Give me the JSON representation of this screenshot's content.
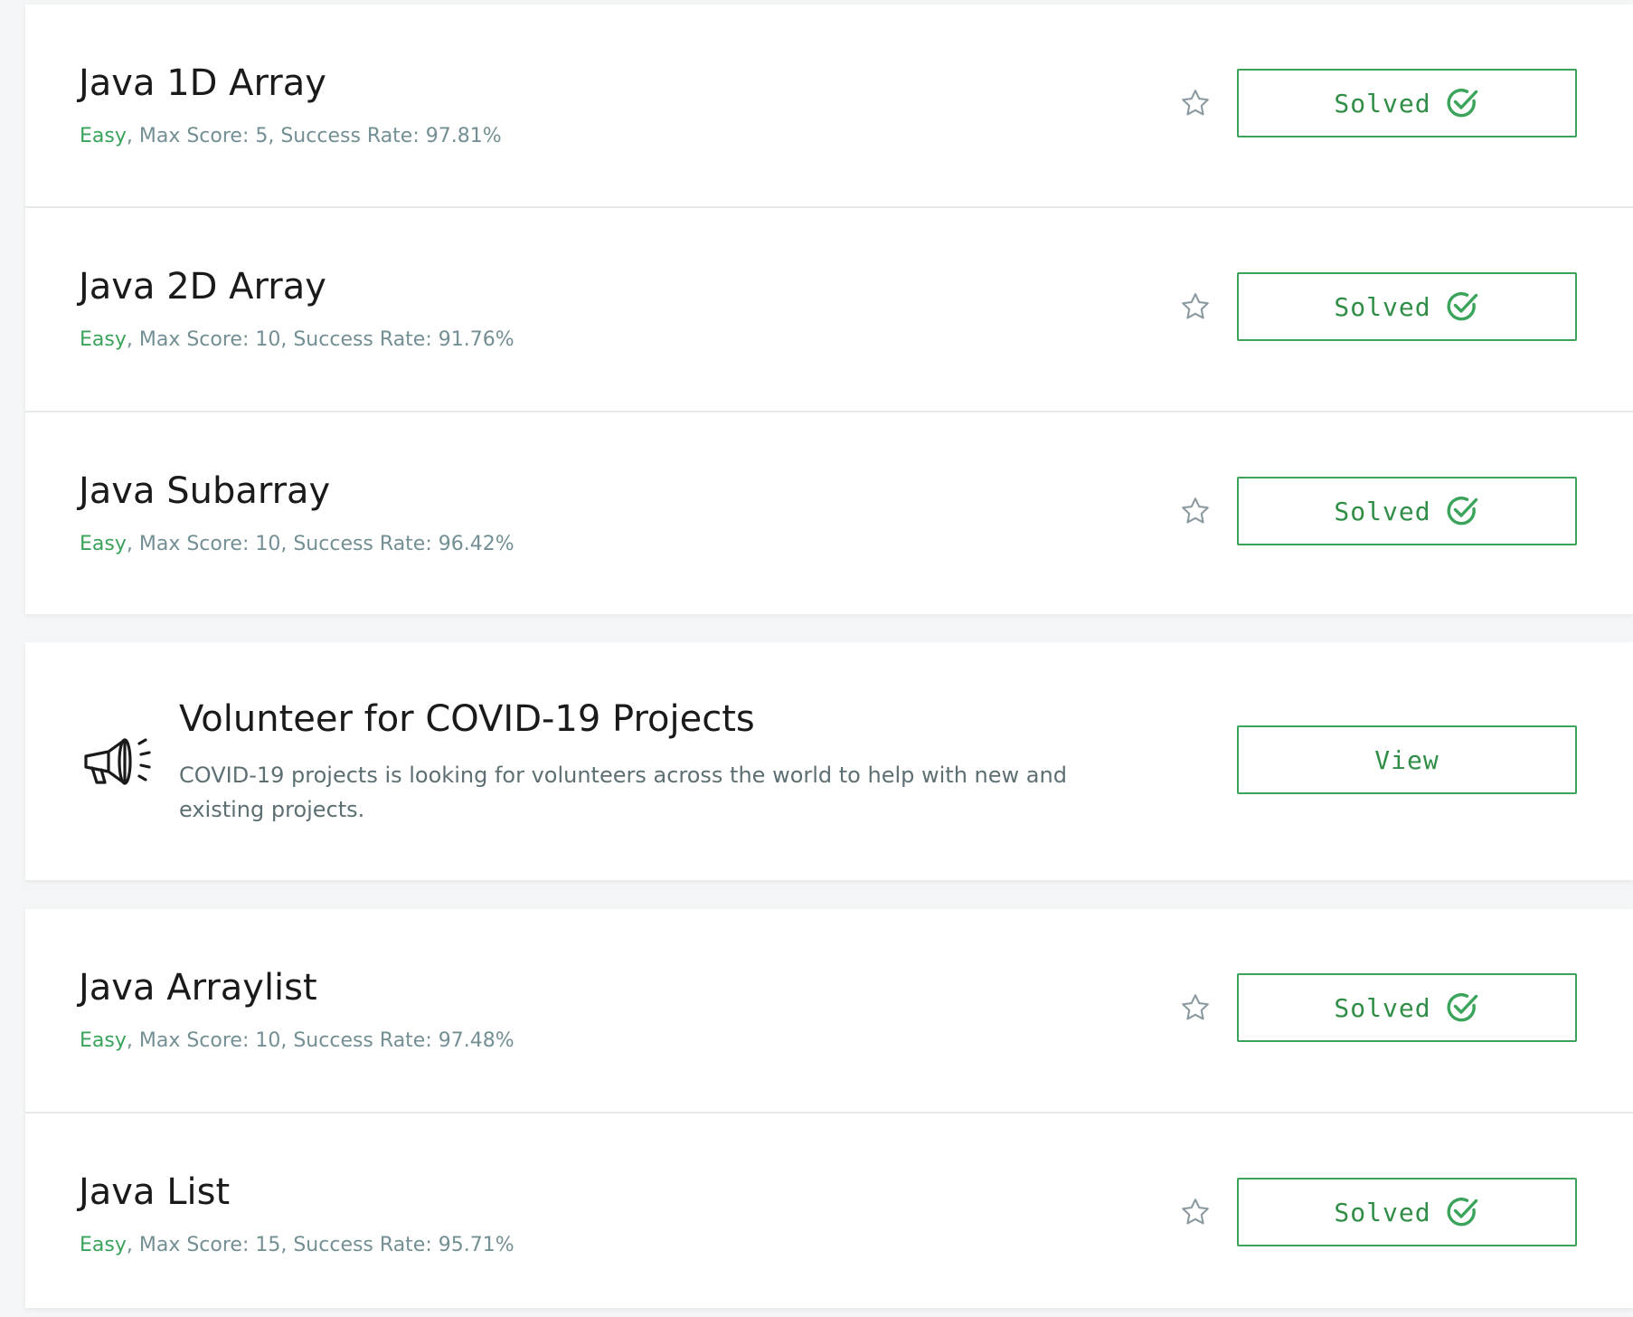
{
  "challenges_top": [
    {
      "title": "Java 1D Array",
      "difficulty": "Easy",
      "meta_rest": ", Max Score: 5, Success Rate: 97.81%",
      "status": "Solved"
    },
    {
      "title": "Java 2D Array",
      "difficulty": "Easy",
      "meta_rest": ", Max Score: 10, Success Rate: 91.76%",
      "status": "Solved"
    },
    {
      "title": "Java Subarray",
      "difficulty": "Easy",
      "meta_rest": ", Max Score: 10, Success Rate: 96.42%",
      "status": "Solved"
    }
  ],
  "promo": {
    "title": "Volunteer for COVID-19 Projects",
    "description": "COVID-19 projects is looking for volunteers across the world to help with new and existing projects.",
    "button_label": "View",
    "icon": "megaphone-icon"
  },
  "challenges_bottom": [
    {
      "title": "Java Arraylist",
      "difficulty": "Easy",
      "meta_rest": ", Max Score: 10, Success Rate: 97.48%",
      "status": "Solved"
    },
    {
      "title": "Java List",
      "difficulty": "Easy",
      "meta_rest": ", Max Score: 15, Success Rate: 95.71%",
      "status": "Solved"
    }
  ],
  "icons": {
    "bookmark": "star-icon",
    "solved": "check-circle-icon"
  },
  "colors": {
    "accent_green": "#39a35c",
    "meta_gray": "#738f93",
    "background": "#f3f5f6"
  }
}
